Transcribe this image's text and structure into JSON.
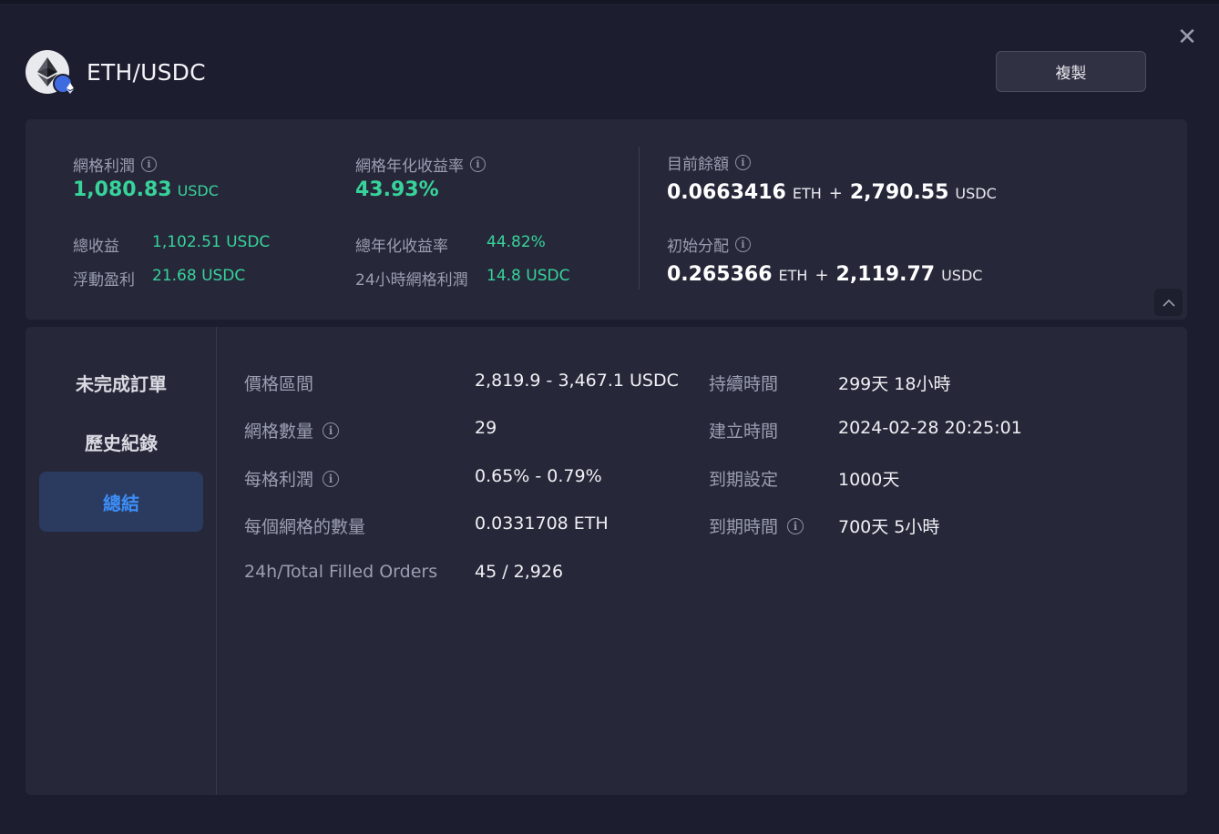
{
  "pair": {
    "title": "ETH/USDC",
    "icon": "ethereum-coin-icon",
    "badge_icon": "ethereum-network-badge-icon"
  },
  "actions": {
    "copy_label": "複製",
    "close_icon": "close-icon"
  },
  "stats": {
    "grid_profit": {
      "label": "網格利潤",
      "value": "1,080.83",
      "unit": "USDC"
    },
    "grid_apr": {
      "label": "網格年化收益率",
      "value": "43.93%"
    },
    "total_profit": {
      "label": "總收益",
      "value": "1,102.51 USDC"
    },
    "floating_pnl": {
      "label": "浮動盈利",
      "value": "21.68 USDC"
    },
    "total_apr": {
      "label": "總年化收益率",
      "value": "44.82%"
    },
    "grid_profit_24h": {
      "label": "24小時網格利潤",
      "value": "14.8 USDC"
    },
    "current_balance": {
      "label": "目前餘額",
      "eth_value": "0.0663416",
      "eth_unit": "ETH",
      "plus": "+",
      "usdc_value": "2,790.55",
      "usdc_unit": "USDC"
    },
    "initial_allocation": {
      "label": "初始分配",
      "eth_value": "0.265366",
      "eth_unit": "ETH",
      "plus": "+",
      "usdc_value": "2,119.77",
      "usdc_unit": "USDC"
    }
  },
  "tabs": [
    {
      "label": "未完成訂單",
      "active": false
    },
    {
      "label": "歷史紀錄",
      "active": false
    },
    {
      "label": "總結",
      "active": true
    }
  ],
  "summary": {
    "left": [
      {
        "label": "價格區間",
        "value": "2,819.9 - 3,467.1 USDC",
        "info": false
      },
      {
        "label": "網格數量",
        "value": "29",
        "info": true
      },
      {
        "label": "每格利潤",
        "value": "0.65% - 0.79%",
        "info": true
      },
      {
        "label": "每個網格的數量",
        "value": "0.0331708 ETH",
        "info": false
      },
      {
        "label": "24h/Total Filled Orders",
        "value": "45 / 2,926",
        "info": false
      }
    ],
    "right": [
      {
        "label": "持續時間",
        "value": "299天 18小時",
        "info": false
      },
      {
        "label": "建立時間",
        "value": "2024-02-28 20:25:01",
        "info": false
      },
      {
        "label": "到期設定",
        "value": "1000天",
        "info": false
      },
      {
        "label": "到期時間",
        "value": "700天 5小時",
        "info": true
      }
    ]
  },
  "colors": {
    "background": "#1c1d2e",
    "panel": "#262839",
    "positive": "#37d39a",
    "accent": "#3d8ef8",
    "active_tab_bg": "#2a3b5f"
  }
}
